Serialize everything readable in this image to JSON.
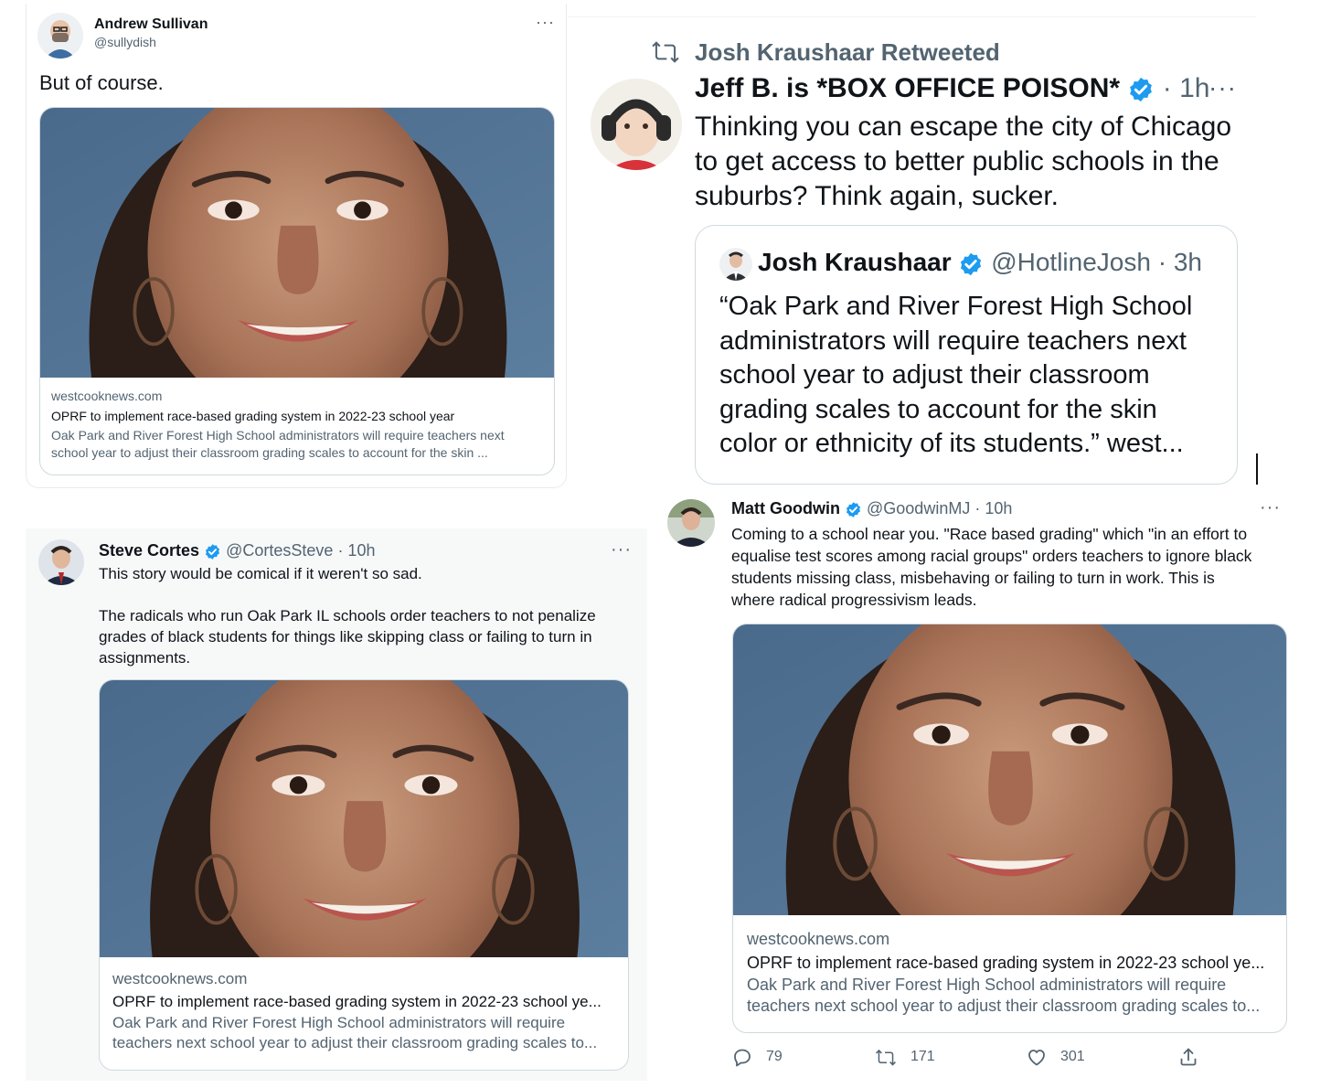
{
  "card_link": {
    "domain": "westcooknews.com",
    "title": "OPRF to implement race-based grading system in 2022-23 school year",
    "title_short": "OPRF to implement race-based grading system in 2022-23 school ye...",
    "desc_a1": "Oak Park and River Forest High School administrators will require teachers next",
    "desc_a2": "school year to adjust their classroom grading scales to account for the skin ...",
    "desc_b1": "Oak Park and River Forest High School administrators will require",
    "desc_b2": "teachers next school year to adjust their classroom grading scales to..."
  },
  "tweet_sullivan": {
    "name": "Andrew Sullivan",
    "handle": "@sullydish",
    "text": "But of course."
  },
  "tweet_jeff": {
    "retweet_label": "Josh Kraushaar Retweeted",
    "name": "Jeff B. is *BOX OFFICE POISON*",
    "time": "· 1h",
    "text_1": "Thinking you can escape the city of Chicago",
    "text_2": "to get access to better public schools in the",
    "text_3": "suburbs? Think again, sucker.",
    "quoted": {
      "name": "Josh Kraushaar",
      "handle": "@HotlineJosh",
      "time": "· 3h",
      "text_1": "“Oak Park and River Forest High School",
      "text_2": "administrators will require teachers next",
      "text_3": "school year to adjust their classroom",
      "text_4": "grading scales to account for the skin",
      "text_5": "color or ethnicity of its students.” west..."
    }
  },
  "tweet_cortes": {
    "name": "Steve Cortes",
    "handle": "@CortesSteve",
    "time": "· 10h",
    "text_1": "This story would be comical if it weren't so sad.",
    "text_2": "The radicals who run Oak Park IL schools order teachers to not penalize",
    "text_3": "grades of black students for things like skipping class or failing to turn in",
    "text_4": "assignments."
  },
  "tweet_goodwin": {
    "name": "Matt Goodwin",
    "handle": "@GoodwinMJ",
    "time": "· 10h",
    "text_1": "Coming to a school near you. \"Race based grading\" which \"in an effort to",
    "text_2": "equalise test scores among racial groups\" orders teachers to ignore black",
    "text_3": "students missing class, misbehaving or failing to turn in work. This is",
    "text_4": "where radical progressivism leads.",
    "reply_count": "79",
    "retweet_count": "171",
    "like_count": "301"
  },
  "more_glyph": "···",
  "colors": {
    "verified_blue": "#1d9bf0",
    "muted": "#536471",
    "border": "#cfd9de",
    "photo_bg": "#4f6f8f"
  },
  "icons": [
    "verified-icon",
    "retweet-icon",
    "reply-icon",
    "like-icon",
    "share-icon",
    "more-icon"
  ]
}
